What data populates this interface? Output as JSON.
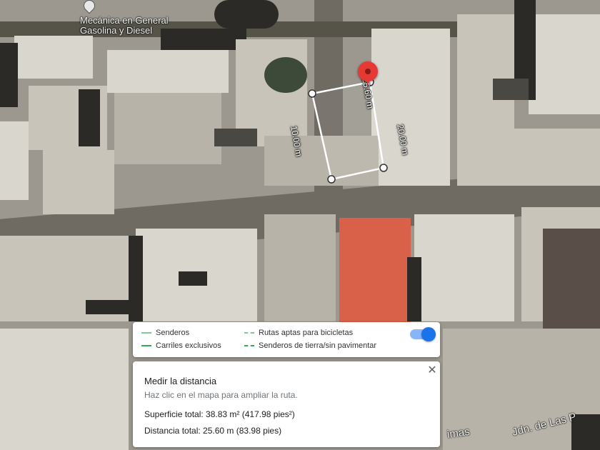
{
  "map": {
    "poi": {
      "name_line1": "Mecánica en General",
      "name_line2": "Gasolina y Diesel"
    },
    "street_label_1": "Jdn. de Las P",
    "street_label_2": "imas",
    "measurement": {
      "top_edge": "25.60 m",
      "right_edge": "20.00 m",
      "left_edge": "10.00 m"
    }
  },
  "legend": {
    "items": [
      {
        "label": "Senderos",
        "icon": "solid-light-green-line"
      },
      {
        "label": "Carriles exclusivos",
        "icon": "solid-green-line"
      },
      {
        "label": "Rutas aptas para bicicletas",
        "icon": "dashed-light-green-line"
      },
      {
        "label": "Senderos de tierra/sin pavimentar",
        "icon": "dashed-green-line"
      }
    ],
    "toggle_on": true
  },
  "measure_panel": {
    "title": "Medir la distancia",
    "hint": "Haz clic en el mapa para ampliar la ruta.",
    "area": "Superficie total: 38.83 m² (417.98 pies²)",
    "distance": "Distancia total: 25.60 m (83.98 pies)"
  },
  "colors": {
    "accent": "#1a73e8",
    "pin": "#e53935",
    "path_green": "#34a853"
  }
}
